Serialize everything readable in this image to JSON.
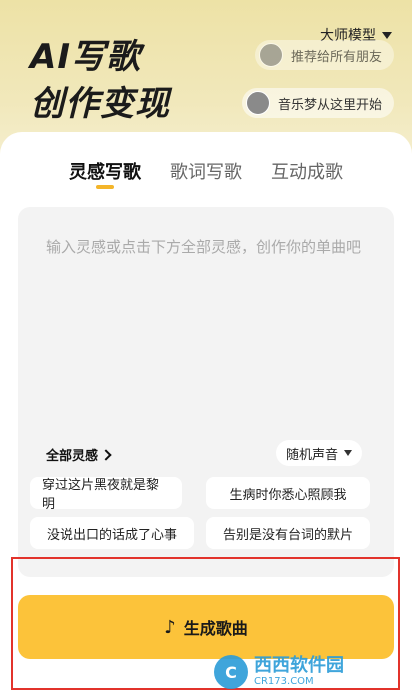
{
  "hero": {
    "title_line1": "AI写歌",
    "title_line2": "创作变现",
    "model_label": "大师模型",
    "pills": [
      {
        "text": "推荐给所有朋友"
      },
      {
        "text": "音乐梦从这里开始"
      }
    ]
  },
  "tabs": [
    {
      "label": "灵感写歌",
      "active": true
    },
    {
      "label": "歌词写歌",
      "active": false
    },
    {
      "label": "互动成歌",
      "active": false
    }
  ],
  "editor": {
    "placeholder": "输入灵感或点击下方全部灵感，创作你的单曲吧",
    "all_inspirations_label": "全部灵感",
    "voice_label": "随机声音",
    "suggestions": [
      "穿过这片黑夜就是黎明",
      "生病时你悉心照顾我",
      "没说出口的话成了心事",
      "告别是没有台词的默片"
    ]
  },
  "generate_button": {
    "label": "生成歌曲"
  },
  "watermark": {
    "main": "西西软件园",
    "sub": "CR173.COM"
  },
  "colors": {
    "accent": "#fcc33a",
    "tab_indicator": "#f4b52a",
    "highlight_frame": "#e2332b"
  }
}
